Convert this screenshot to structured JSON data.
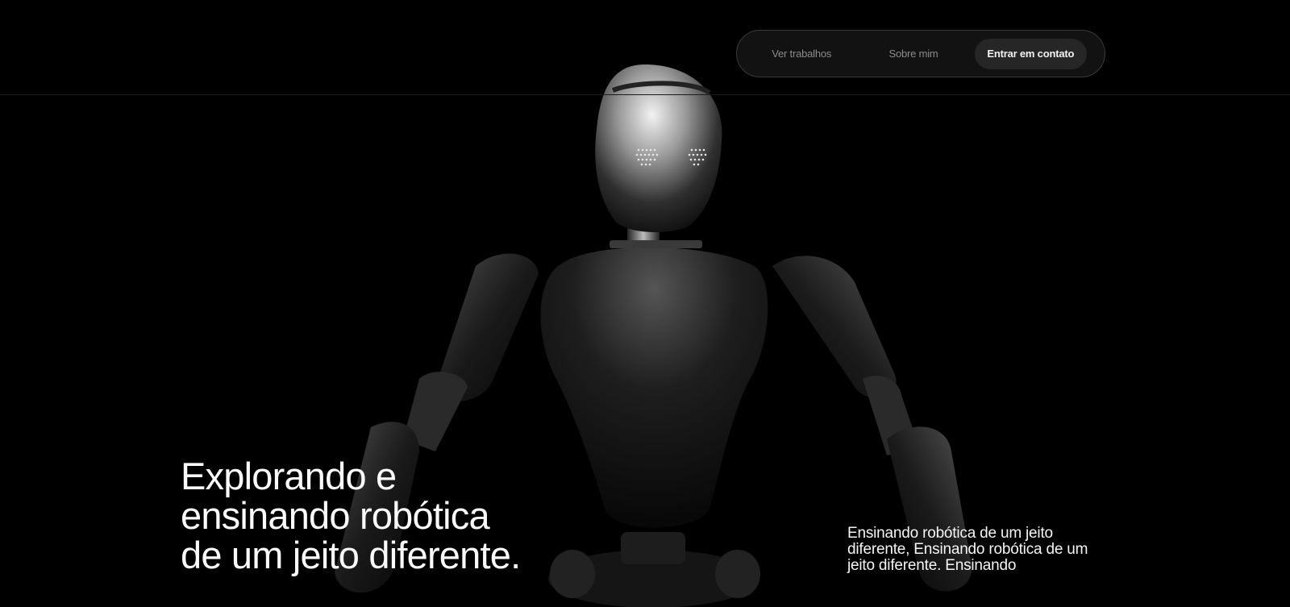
{
  "nav": {
    "items": [
      {
        "label": "Ver trabalhos"
      },
      {
        "label": "Sobre mim"
      },
      {
        "label": "Entrar em contato"
      }
    ],
    "active_index": 2
  },
  "hero": {
    "headline_lines": [
      "Explorando e",
      "ensinando robótica",
      "de um jeito diferente."
    ],
    "subtext": "Ensinando robótica de um jeito diferente, Ensinando robótica de um jeito diferente. Ensinando",
    "image": "humanoid-robot"
  },
  "colors": {
    "background": "#000000",
    "text": "#fafafa",
    "nav_link": "#8b8b8b",
    "nav_active_bg": "#262626"
  }
}
